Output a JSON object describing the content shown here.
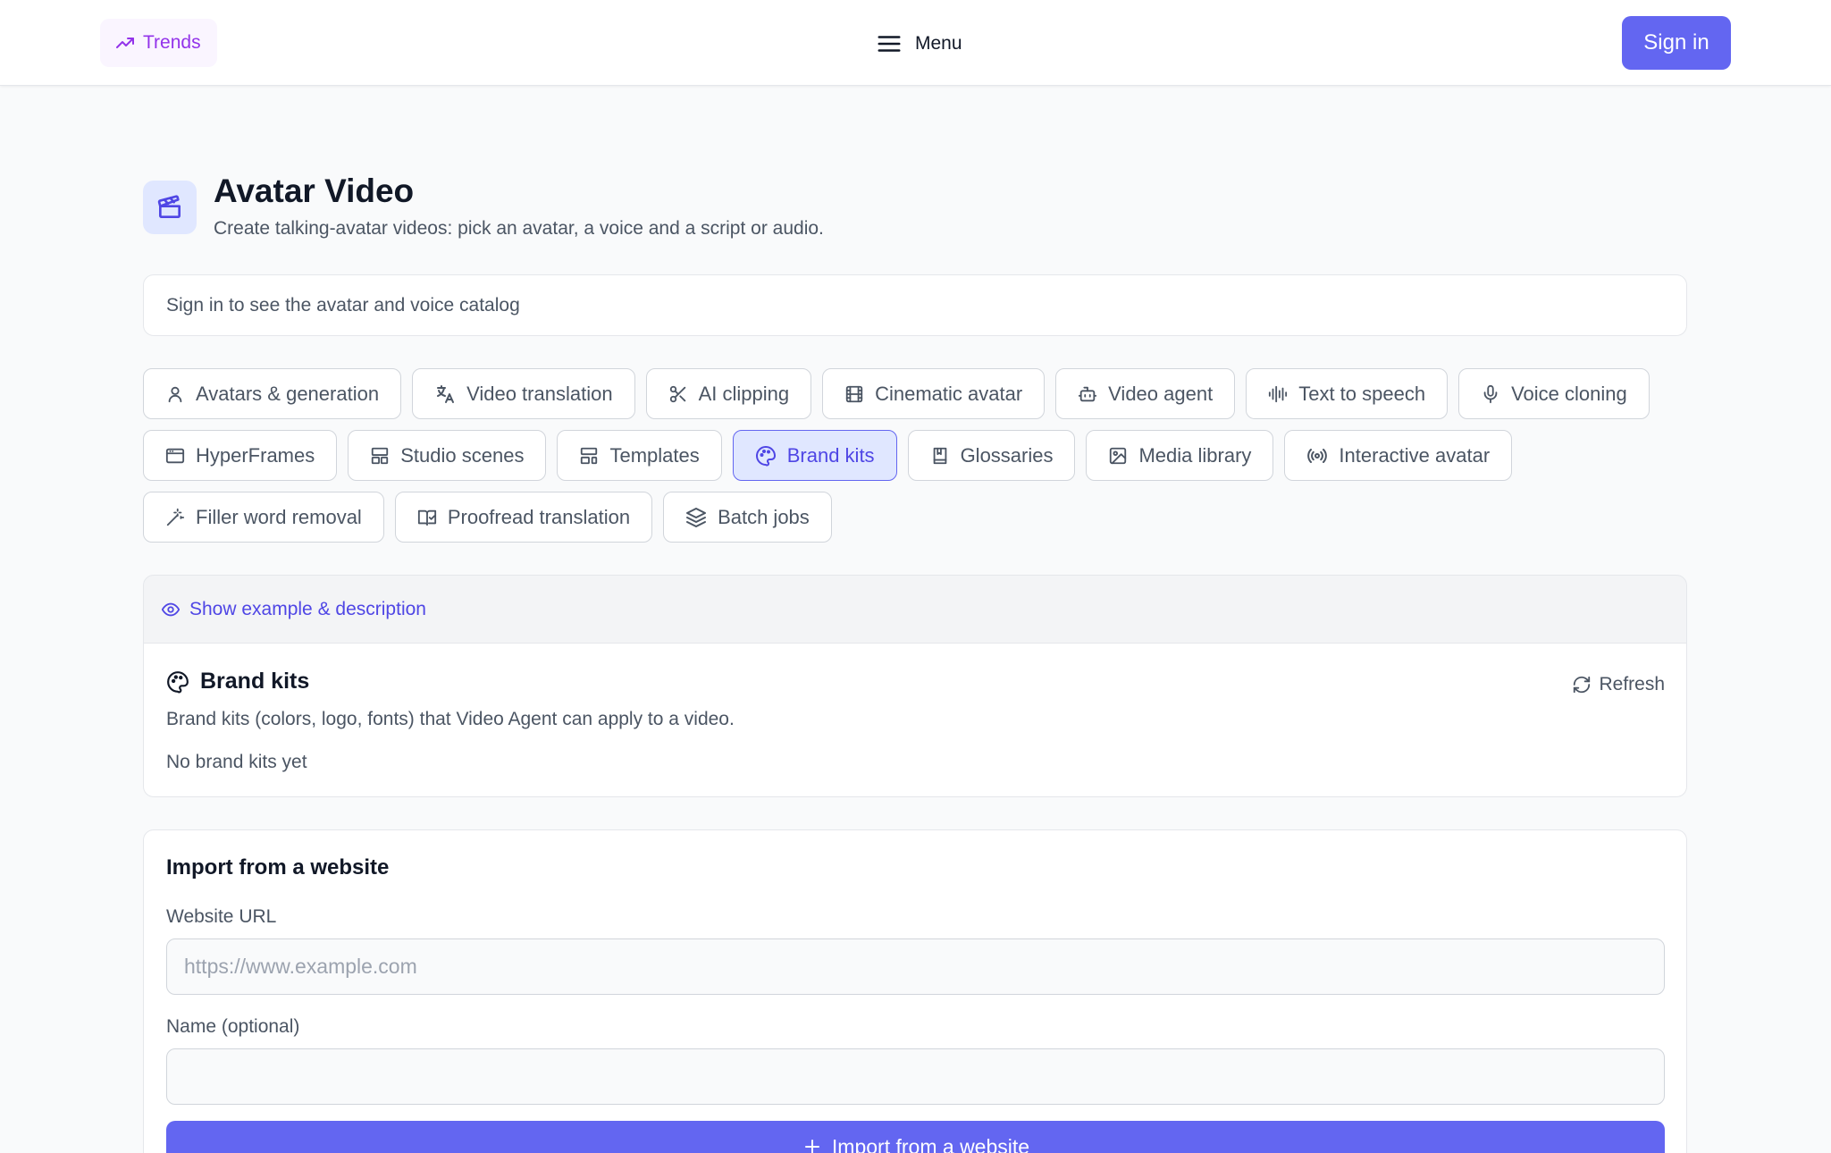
{
  "header": {
    "trends_label": "Trends",
    "menu_label": "Menu",
    "signin_label": "Sign in"
  },
  "page": {
    "title": "Avatar Video",
    "subtitle": "Create talking-avatar videos: pick an avatar, a voice and a script or audio.",
    "icon": "clapperboard-icon"
  },
  "notice": "Sign in to see the avatar and voice catalog",
  "tabs": [
    {
      "label": "Avatars & generation",
      "icon": "user-icon"
    },
    {
      "label": "Video translation",
      "icon": "languages-icon"
    },
    {
      "label": "AI clipping",
      "icon": "scissors-icon"
    },
    {
      "label": "Cinematic avatar",
      "icon": "film-icon"
    },
    {
      "label": "Video agent",
      "icon": "bot-icon"
    },
    {
      "label": "Text to speech",
      "icon": "audio-lines-icon"
    },
    {
      "label": "Voice cloning",
      "icon": "mic-icon"
    },
    {
      "label": "HyperFrames",
      "icon": "browser-icon"
    },
    {
      "label": "Studio scenes",
      "icon": "layout-icon"
    },
    {
      "label": "Templates",
      "icon": "layout-template-icon"
    },
    {
      "label": "Brand kits",
      "icon": "palette-icon",
      "active": true
    },
    {
      "label": "Glossaries",
      "icon": "book-icon"
    },
    {
      "label": "Media library",
      "icon": "image-icon"
    },
    {
      "label": "Interactive avatar",
      "icon": "radio-icon"
    },
    {
      "label": "Filler word removal",
      "icon": "wand-icon"
    },
    {
      "label": "Proofread translation",
      "icon": "book-check-icon"
    },
    {
      "label": "Batch jobs",
      "icon": "layers-icon"
    }
  ],
  "example_toggle": "Show example & description",
  "brand_kits": {
    "title": "Brand kits",
    "refresh_label": "Refresh",
    "description": "Brand kits (colors, logo, fonts) that Video Agent can apply to a video.",
    "empty_text": "No brand kits yet"
  },
  "import": {
    "title": "Import from a website",
    "url_label": "Website URL",
    "url_placeholder": "https://www.example.com",
    "url_value": "",
    "name_label": "Name (optional)",
    "name_value": "",
    "button_label": "Import from a website"
  },
  "colors": {
    "accent": "#6366f1",
    "accent_text": "#4f46e5",
    "trends": "#9333ea"
  }
}
